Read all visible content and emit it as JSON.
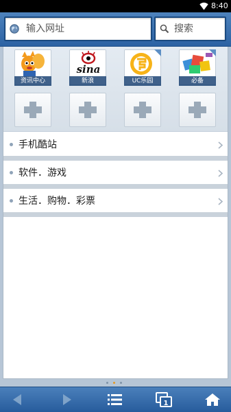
{
  "status_bar": {
    "time": "8:40",
    "wifi_icon": "wifi-icon"
  },
  "address_bar": {
    "placeholder": "输入网址",
    "icon": "globe-icon"
  },
  "search_box": {
    "placeholder": "搜索",
    "icon": "search-icon"
  },
  "quick_access": {
    "tiles": [
      {
        "label": "资讯中心",
        "icon": "uc-squirrel-icon"
      },
      {
        "label": "新浪",
        "icon": "sina-logo-icon"
      },
      {
        "label": "UC乐园",
        "icon": "uc-leyuan-icon"
      },
      {
        "label": "必备",
        "icon": "app-boxes-icon"
      }
    ],
    "add_slots": 4
  },
  "categories": [
    {
      "label": "手机酷站"
    },
    {
      "label": "软件．游戏"
    },
    {
      "label": "生活．购物．彩票"
    }
  ],
  "page_indicator": {
    "count": 3,
    "active": 2
  },
  "toolbar": {
    "back_icon": "back-arrow-icon",
    "forward_icon": "forward-arrow-icon",
    "menu_icon": "menu-icon",
    "windows_icon": "windows-icon",
    "window_count": "1",
    "home_icon": "home-icon"
  },
  "colors": {
    "header_blue": "#3a70b0",
    "toolbar_blue": "#356aa9",
    "active_dot": "#e69a23"
  }
}
